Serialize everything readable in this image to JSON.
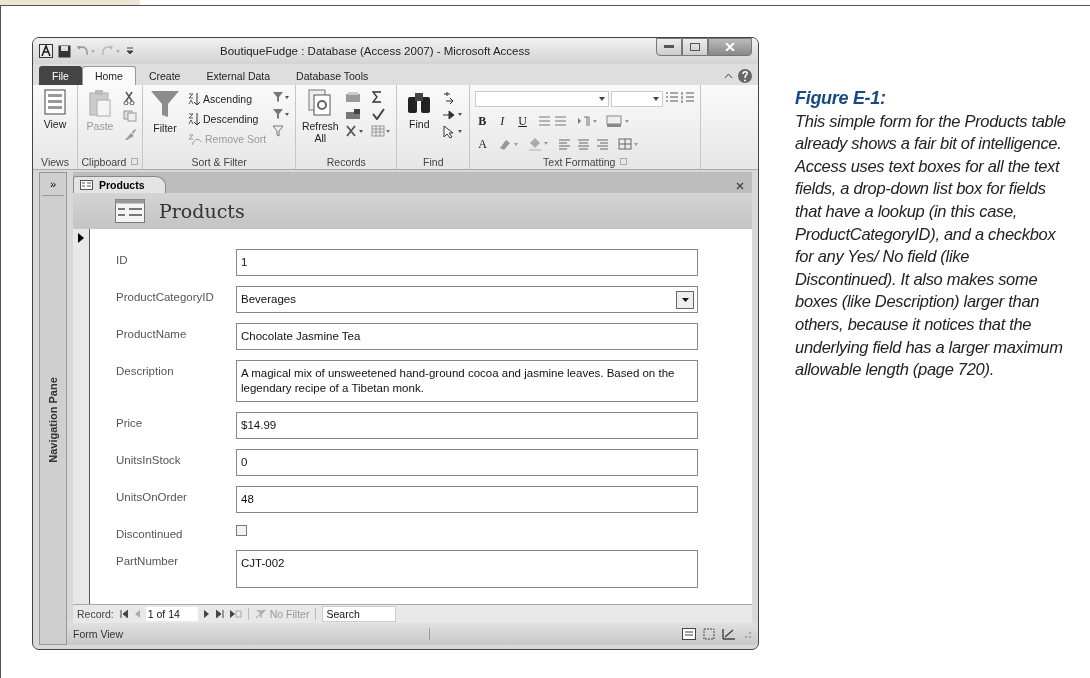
{
  "window": {
    "title": "BoutiqueFudge : Database (Access 2007)  -  Microsoft Access"
  },
  "ribbon_tabs": [
    {
      "label": "File",
      "kind": "file",
      "selected": false
    },
    {
      "label": "Home",
      "kind": "tab",
      "selected": true
    },
    {
      "label": "Create",
      "kind": "tab",
      "selected": false
    },
    {
      "label": "External Data",
      "kind": "tab",
      "selected": false
    },
    {
      "label": "Database Tools",
      "kind": "tab",
      "selected": false
    }
  ],
  "ribbon_groups": [
    {
      "label": "Views",
      "kind": "views",
      "buttons": [
        {
          "label": "View",
          "disabled": false
        }
      ]
    },
    {
      "label": "Clipboard",
      "kind": "clipboard",
      "buttons": [
        {
          "label": "Paste",
          "disabled": true
        }
      ]
    },
    {
      "label": "Sort & Filter",
      "kind": "sort",
      "buttons": [
        {
          "label": "Filter",
          "disabled": false
        },
        {
          "label": "Ascending",
          "disabled": false
        },
        {
          "label": "Descending",
          "disabled": false
        },
        {
          "label": "Remove Sort",
          "disabled": true
        }
      ]
    },
    {
      "label": "Records",
      "kind": "records",
      "buttons": [
        {
          "label": "Refresh All",
          "disabled": false
        }
      ]
    },
    {
      "label": "Find",
      "kind": "find",
      "buttons": [
        {
          "label": "Find",
          "disabled": false
        }
      ]
    },
    {
      "label": "Text Formatting",
      "kind": "text",
      "buttons": [
        {
          "label": "B",
          "disabled": false
        },
        {
          "label": "I",
          "disabled": false
        },
        {
          "label": "U",
          "disabled": false
        },
        {
          "label": "A",
          "disabled": false
        }
      ]
    }
  ],
  "nav_pane": {
    "toggle": "»",
    "label": "Navigation Pane"
  },
  "document_tab": {
    "label": "Products"
  },
  "form": {
    "title": "Products",
    "fields": [
      {
        "label": "ID",
        "kind": "text",
        "value": "1"
      },
      {
        "label": "ProductCategoryID",
        "kind": "combo",
        "value": "Beverages"
      },
      {
        "label": "ProductName",
        "kind": "text",
        "value": "Chocolate Jasmine Tea"
      },
      {
        "label": "Description",
        "kind": "memo",
        "value": "A magical mix of unsweetened hand-ground cocoa and jasmine leaves. Based on the legendary recipe of a Tibetan monk."
      },
      {
        "label": "Price",
        "kind": "text",
        "value": "$14.99"
      },
      {
        "label": "UnitsInStock",
        "kind": "text",
        "value": "0"
      },
      {
        "label": "UnitsOnOrder",
        "kind": "text",
        "value": "48"
      },
      {
        "label": "Discontinued",
        "kind": "checkbox",
        "checked": false
      },
      {
        "label": "PartNumber",
        "kind": "memo",
        "value": "CJT-002"
      }
    ]
  },
  "record_nav": {
    "label": "Record:",
    "position": "1 of 14",
    "filter": "No Filter",
    "search": {
      "placeholder": "Search"
    }
  },
  "status_bar": {
    "text": "Form View"
  },
  "caption": {
    "title": "Figure E-1:",
    "text": "This simple form for the Products table already shows a fair bit of intelligence. Access uses text boxes for all the text fields, a drop-down list box for fields that have a lookup (in this case, ProductCategoryID), and a checkbox for any Yes/ No field (like Discontinued). It also makes some boxes (like Description) larger than others, because it notices that the underlying field has a larger maximum allowable length (page 720)."
  }
}
